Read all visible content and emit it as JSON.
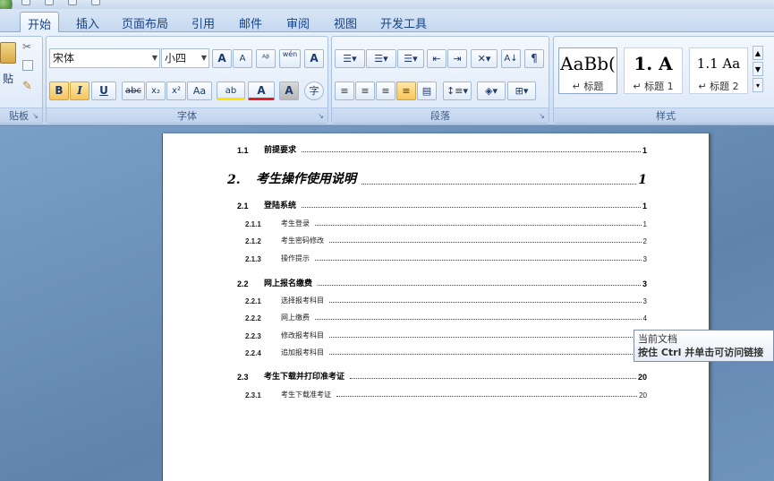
{
  "tabs": [
    "开始",
    "插入",
    "页面布局",
    "引用",
    "邮件",
    "审阅",
    "视图",
    "开发工具"
  ],
  "ribbon": {
    "clipboard": {
      "label": "贴板",
      "paste_label": "贴"
    },
    "font": {
      "label": "字体",
      "family": "宋体",
      "size": "小四",
      "grow": "A",
      "shrink": "A",
      "phonetic": "wén",
      "bold": "B",
      "italic": "I",
      "underline": "U",
      "strike": "abc",
      "sub": "x₂",
      "sup": "x²",
      "case": "Aa",
      "highlight": "ab",
      "color": "A",
      "charshade": "A",
      "enclose": "字"
    },
    "paragraph": {
      "label": "段落"
    },
    "styles": {
      "label": "样式",
      "items": [
        {
          "preview": "AaBb(",
          "name": "标题"
        },
        {
          "preview": "1.  A",
          "name": "标题 1"
        },
        {
          "preview": "1.1  Aa",
          "name": "标题 2"
        }
      ]
    }
  },
  "toc": [
    {
      "level": 2,
      "num": "1.1",
      "text": "前提要求",
      "page": "1"
    },
    {
      "level": 1,
      "num": "2.",
      "text": "考生操作使用说明",
      "page": "1"
    },
    {
      "level": 2,
      "num": "2.1",
      "text": "登陆系统",
      "page": "1"
    },
    {
      "level": 3,
      "num": "2.1.1",
      "text": "考生登录",
      "page": "1"
    },
    {
      "level": 3,
      "num": "2.1.2",
      "text": "考生密码修改",
      "page": "2"
    },
    {
      "level": 3,
      "num": "2.1.3",
      "text": "操作提示",
      "page": "3"
    },
    {
      "level": 2,
      "num": "2.2",
      "text": "网上报名缴费",
      "page": "3"
    },
    {
      "level": 3,
      "num": "2.2.1",
      "text": "选择报考科目",
      "page": "3"
    },
    {
      "level": 3,
      "num": "2.2.2",
      "text": "网上缴费",
      "page": "4"
    },
    {
      "level": 3,
      "num": "2.2.3",
      "text": "修改报考科目",
      "page": ""
    },
    {
      "level": 3,
      "num": "2.2.4",
      "text": "追加报考科目",
      "page": ""
    },
    {
      "level": 2,
      "num": "2.3",
      "text": "考生下载并打印准考证",
      "page": "20"
    },
    {
      "level": 3,
      "num": "2.3.1",
      "text": "考生下载准考证",
      "page": "20"
    }
  ],
  "tooltip": {
    "line1": "当前文档",
    "line2_prefix": "按住 ",
    "line2_key": "Ctrl",
    "line2_suffix": " 并单击可访问链接"
  },
  "colors": {
    "ribbon": "#dce8f7",
    "tab_text": "#15428b",
    "active_button": "#f7c45a",
    "workspace": "#6f8fb6"
  }
}
